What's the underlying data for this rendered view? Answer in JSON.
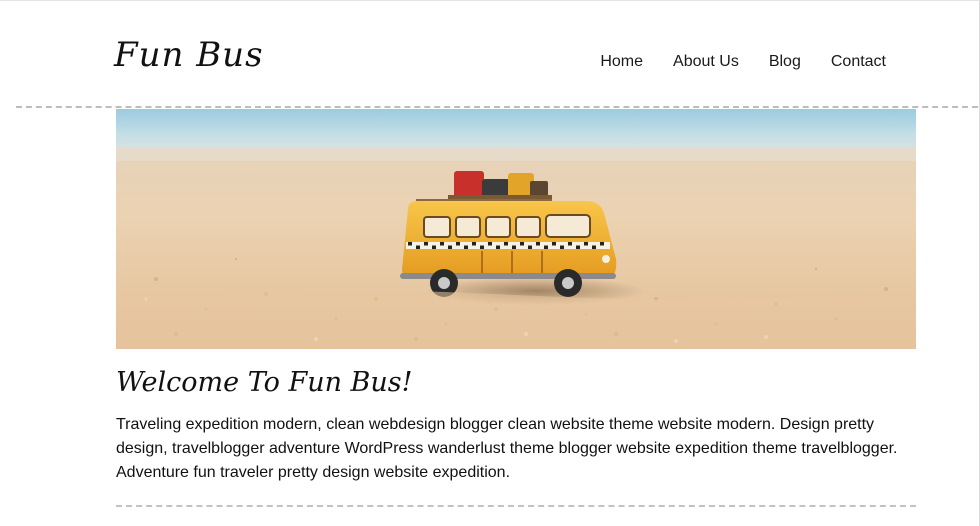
{
  "site": {
    "title": "Fun Bus"
  },
  "nav": {
    "items": [
      {
        "label": "Home"
      },
      {
        "label": "About Us"
      },
      {
        "label": "Blog"
      },
      {
        "label": "Contact"
      }
    ]
  },
  "main": {
    "heading": "Welcome To Fun Bus!",
    "intro": "Traveling expedition modern, clean webdesign blogger clean website theme website modern. Design pretty design, travelblogger adventure WordPress wanderlust theme blogger website expedition theme travelblogger. Adventure fun traveler pretty design website expedition."
  },
  "colors": {
    "bus": "#f2b12c",
    "sand": "#e9cfae",
    "sky": "#a9d3e2"
  }
}
